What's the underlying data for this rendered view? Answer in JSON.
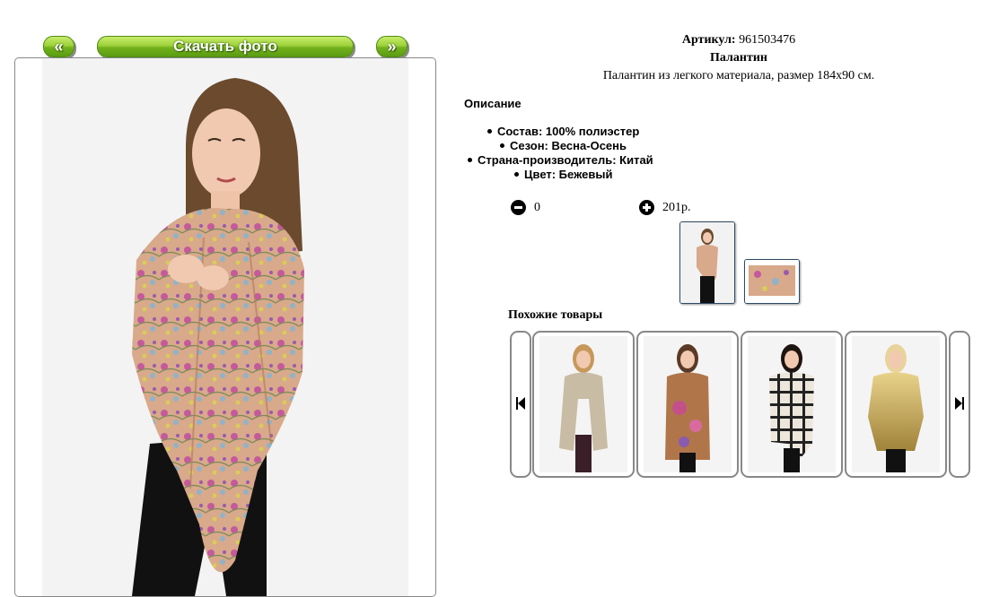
{
  "nav": {
    "prev_label": "«",
    "download_label": "Скачать фото",
    "next_label": "»"
  },
  "product": {
    "sku_label": "Артикул:",
    "sku_value": "961503476",
    "title": "Палантин",
    "description": "Палантин из легкого материала, размер 184x90 см.",
    "description_heading": "Описание",
    "specs": [
      "Состав: 100% полиэстер",
      "Сезон: Весна-Осень",
      "Страна-производитель: Китай",
      "Цвет: Бежевый"
    ]
  },
  "cart": {
    "quantity": "0",
    "price": "201р."
  },
  "similar": {
    "heading": "Похожие товары",
    "items": [
      {
        "name": "beige-scarf"
      },
      {
        "name": "floral-brown-scarf"
      },
      {
        "name": "plaid-scarf"
      },
      {
        "name": "gold-ombre-scarf"
      }
    ]
  },
  "colors": {
    "button_green": "#7cbf22",
    "frame_border": "#888888",
    "thumb_border": "#2d4a66",
    "scarf_main": "#d9a98a",
    "pants": "#111111",
    "hair": "#6b4a2e"
  }
}
